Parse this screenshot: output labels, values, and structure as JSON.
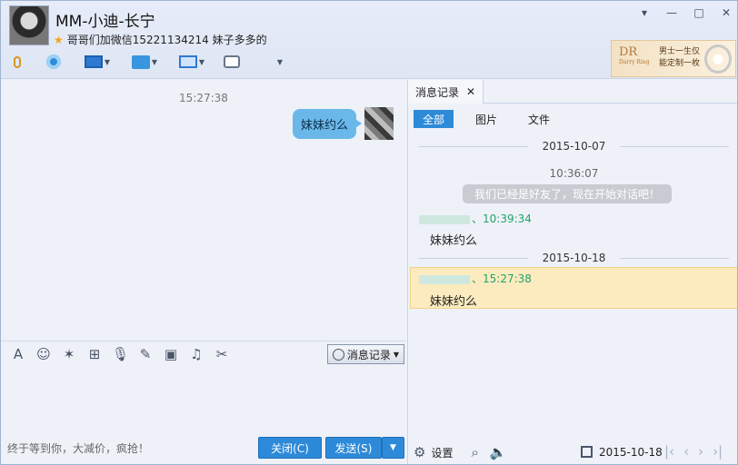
{
  "window": {
    "title": "MM-小迪-长宁",
    "status_line": "哥哥们加微信15221134214  妹子多多的",
    "window_controls": [
      "▾",
      "—",
      "□",
      "✕"
    ]
  },
  "ad_banner": {
    "logo": "DR",
    "logo_sub": "Darry Ring",
    "line1": "男士一生仅",
    "line2": "能定制一枚"
  },
  "toolbar": {
    "items": [
      "mic-icon",
      "camera-icon",
      "screen-share-icon",
      "file-transfer-icon",
      "remote-desktop-icon",
      "group-chat-icon",
      "apps-icon"
    ],
    "colors": [
      "#d8961b",
      "#2c8fd9",
      "#2f79d0",
      "#3895e0",
      "#2f79d0",
      "#6a7789",
      "#e44d3a"
    ]
  },
  "chat": {
    "time": "15:27:38",
    "message": "妹妹约么",
    "input_tools": [
      "A",
      "☺",
      "✶",
      "⊞",
      "🎙",
      "✎",
      "▣",
      "♫",
      "✂"
    ],
    "history_button": "消息记录",
    "ad_text": "终于等到你，大减价，疯抢！",
    "close_button": "关闭(C)",
    "send_button": "发送(S)",
    "send_arrow": "▼"
  },
  "history": {
    "tab_label": "消息记录",
    "tab_close": "✕",
    "filters": [
      "全部",
      "图片",
      "文件"
    ],
    "date1": "2015-10-07",
    "time1": "10:36:07",
    "system_message": "我们已经是好友了，现在开始对话吧！",
    "sender1_time": "、10:39:34",
    "message1": "妹妹约么",
    "date2": "2015-10-18",
    "sender2_time": "、15:27:38",
    "message2": "妹妹约么",
    "settings_label": "设置",
    "footer_date": "2015-10-18",
    "nav": [
      "|‹",
      "‹",
      "›",
      "›|"
    ]
  }
}
